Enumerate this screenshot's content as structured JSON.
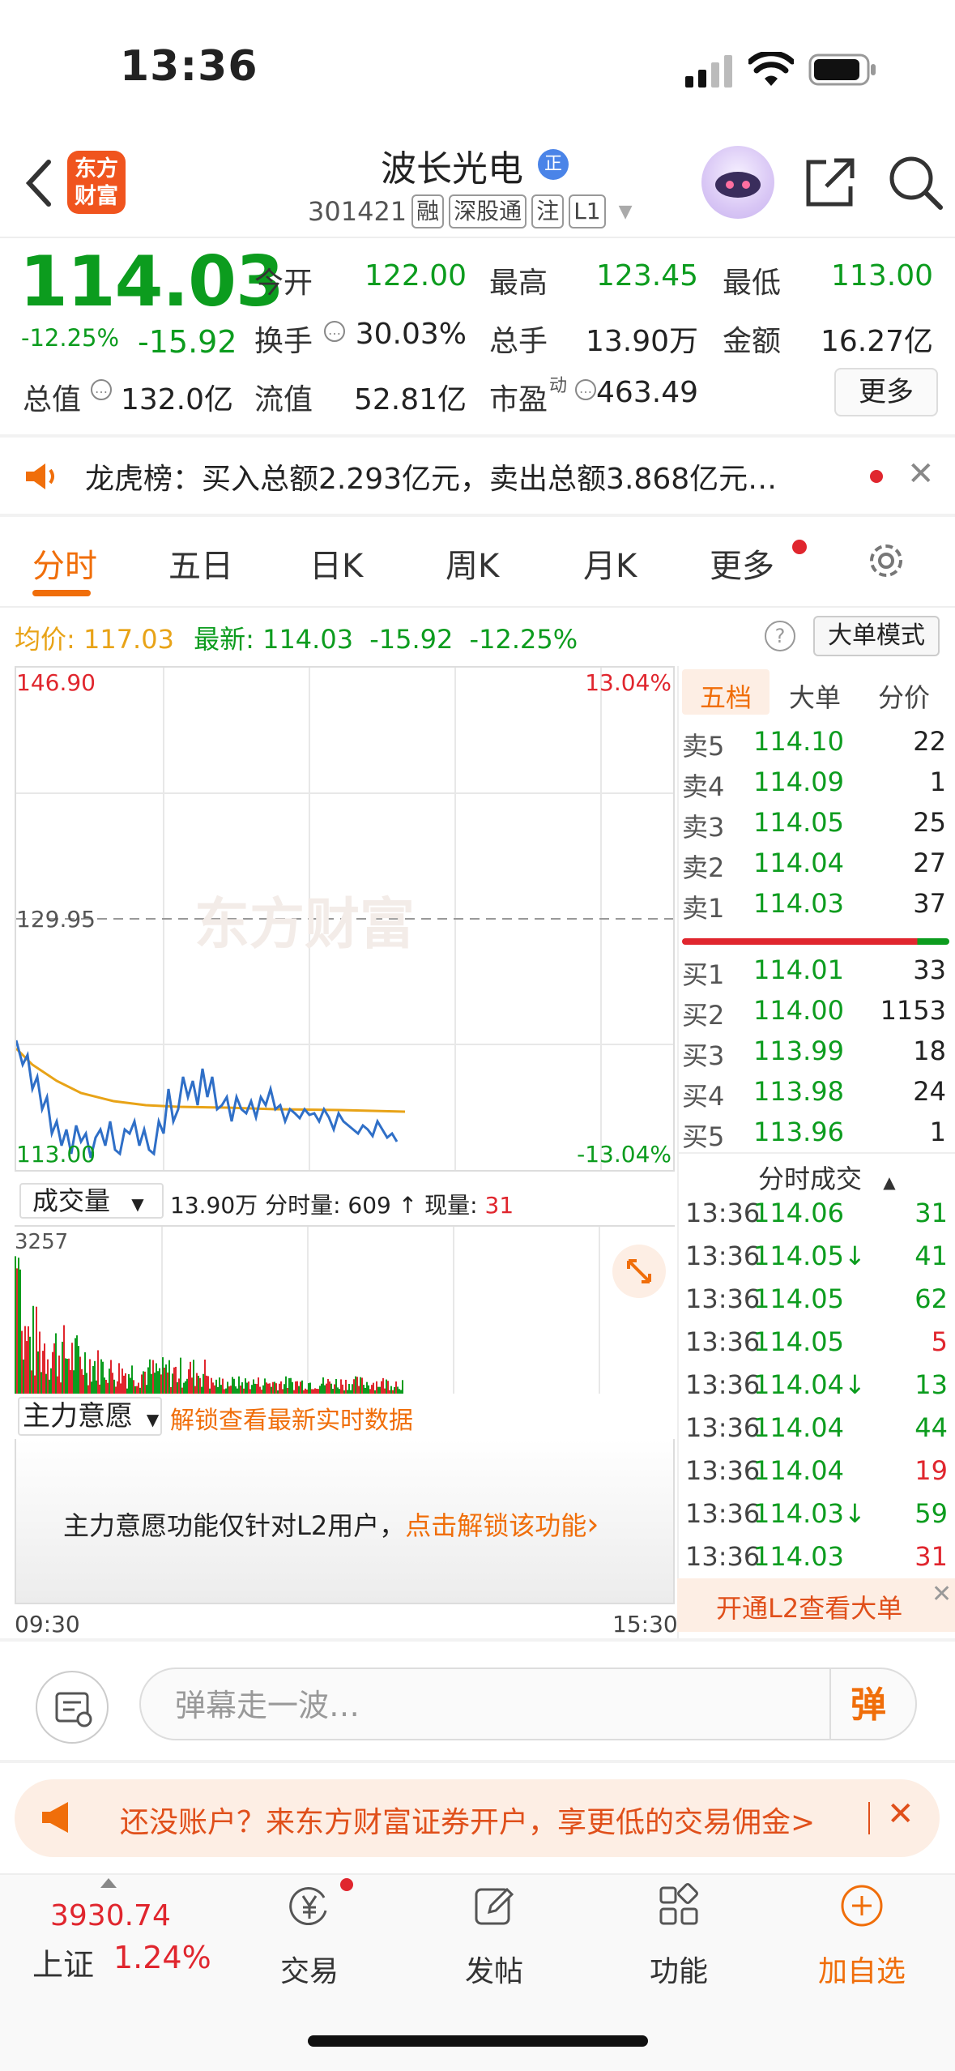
{
  "status_bar": {
    "time": "13:36"
  },
  "header": {
    "logo_line1": "东方",
    "logo_line2": "财富",
    "name": "波长光电",
    "name_badge": "正",
    "code": "301421",
    "tags": [
      "融",
      "深股通",
      "注",
      "L1"
    ]
  },
  "quote": {
    "price": "114.03",
    "pct": "-12.25%",
    "change": "-15.92",
    "open_label": "今开",
    "open": "122.00",
    "high_label": "最高",
    "high": "123.45",
    "low_label": "最低",
    "low": "113.00",
    "turnover_label": "换手",
    "turnover": "30.03%",
    "vol_label": "总手",
    "vol": "13.90万",
    "amount_label": "金额",
    "amount": "16.27亿",
    "mcap_label": "总值",
    "mcap": "132.0亿",
    "float_label": "流值",
    "float": "52.81亿",
    "pe_label": "市盈",
    "pe_sup": "动",
    "pe": "463.49",
    "more": "更多"
  },
  "notice": {
    "text": "龙虎榜：买入总额2.293亿元，卖出总额3.868亿元…"
  },
  "tabs": [
    "分时",
    "五日",
    "日K",
    "周K",
    "月K",
    "更多"
  ],
  "info_line": {
    "avg_label": "均价:",
    "avg": "117.03",
    "latest_label": "最新:",
    "latest": "114.03",
    "chg": "-15.92",
    "pct": "-12.25%",
    "mode": "大单模式"
  },
  "chart": {
    "y_top": "146.90",
    "y_mid": "129.95",
    "y_bot": "113.00",
    "pct_top": "13.04%",
    "pct_bot": "-13.04%",
    "watermark": "东方财富"
  },
  "volume": {
    "select": "成交量",
    "total": "13.90万",
    "fen_label": "分时量:",
    "fen": "609",
    "arrow": "↑",
    "xian_label": "现量:",
    "xian": "31",
    "max": "3257"
  },
  "zhuli": {
    "select": "主力意愿",
    "unlock": "解锁查看最新实时数据",
    "msg": "主力意愿功能仅针对L2用户，",
    "msg_link": "点击解锁该功能",
    "arrow": "›"
  },
  "time_axis": {
    "start": "09:30",
    "end": "15:30"
  },
  "right_tabs": [
    "五档",
    "大单",
    "分价"
  ],
  "asks": [
    {
      "label": "卖5",
      "price": "114.10",
      "vol": "22"
    },
    {
      "label": "卖4",
      "price": "114.09",
      "vol": "1"
    },
    {
      "label": "卖3",
      "price": "114.05",
      "vol": "25"
    },
    {
      "label": "卖2",
      "price": "114.04",
      "vol": "27"
    },
    {
      "label": "卖1",
      "price": "114.03",
      "vol": "37"
    }
  ],
  "bids": [
    {
      "label": "买1",
      "price": "114.01",
      "vol": "33"
    },
    {
      "label": "买2",
      "price": "114.00",
      "vol": "1153"
    },
    {
      "label": "买3",
      "price": "113.99",
      "vol": "18"
    },
    {
      "label": "买4",
      "price": "113.98",
      "vol": "24"
    },
    {
      "label": "买5",
      "price": "113.96",
      "vol": "1"
    }
  ],
  "ticks_title": "分时成交",
  "ticks": [
    {
      "time": "13:36",
      "price": "114.06",
      "vol": "31",
      "color": "green"
    },
    {
      "time": "13:36",
      "price": "114.05↓",
      "vol": "41",
      "color": "green"
    },
    {
      "time": "13:36",
      "price": "114.05",
      "vol": "62",
      "color": "green"
    },
    {
      "time": "13:36",
      "price": "114.05",
      "vol": "5",
      "color": "red"
    },
    {
      "time": "13:36",
      "price": "114.04↓",
      "vol": "13",
      "color": "green"
    },
    {
      "time": "13:36",
      "price": "114.04",
      "vol": "44",
      "color": "green"
    },
    {
      "time": "13:36",
      "price": "114.04",
      "vol": "19",
      "color": "red"
    },
    {
      "time": "13:36",
      "price": "114.03↓",
      "vol": "59",
      "color": "green"
    },
    {
      "time": "13:36",
      "price": "114.03",
      "vol": "31",
      "color": "red"
    }
  ],
  "l2": "开通L2查看大单",
  "danmu": {
    "placeholder": "弹幕走一波…",
    "btn": "弹"
  },
  "promo": {
    "text": "还没账户？来东方财富证券开户，享更低的交易佣金>"
  },
  "nav": {
    "index_value": "3930.74",
    "index_name": "上证",
    "index_pct": "1.24%",
    "items": [
      "交易",
      "发帖",
      "功能",
      "加自选"
    ]
  },
  "colors": {
    "green": "#0c9c1e",
    "red": "#e0262e",
    "orange": "#f06e0a"
  }
}
